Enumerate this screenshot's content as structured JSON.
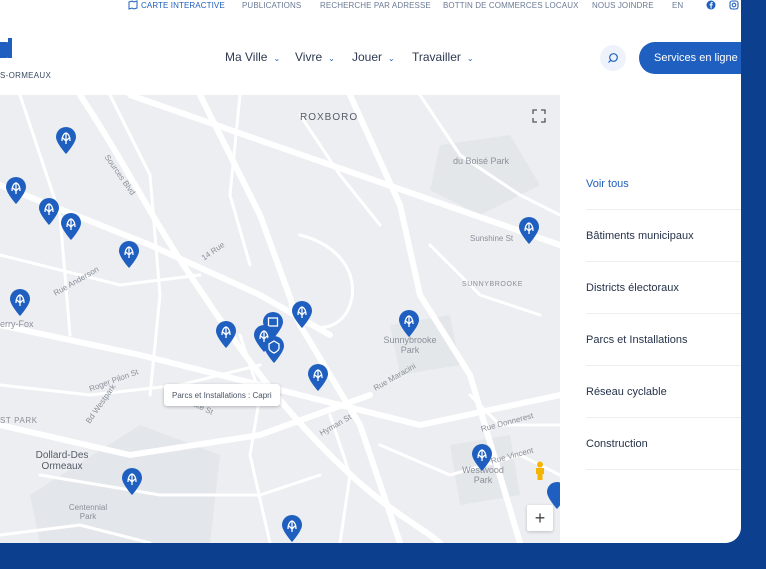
{
  "topbar": {
    "links": [
      "CARTE INTERACTIVE",
      "PUBLICATIONS",
      "RECHERCHE PAR ADRESSE",
      "BOTTIN DE COMMERCES LOCAUX",
      "NOUS JOINDRE",
      "EN"
    ],
    "active_color": "#1f5fbf"
  },
  "logo": {
    "text": "S-ORMEAUX"
  },
  "nav": {
    "items": [
      "Ma Ville",
      "Vivre",
      "Jouer",
      "Travailler"
    ]
  },
  "services_label": "Services en ligne",
  "map": {
    "tooltip": "Parcs et Installations : Capri",
    "labels": [
      "ROXBORO",
      "du Boisé Park",
      "SUNNYBROOKE",
      "Sunshine St",
      "Sunnybrooke Park",
      "Dollard-Des Ormeaux",
      "Centennial Park",
      "Westwood Park",
      "ST PARK",
      "erry-Fox",
      "Sources Blvd",
      "14 Rue",
      "Roger Pilon St",
      "Lake St",
      "Hyman St",
      "Rue Maracini",
      "Rue Donnerest",
      "Rue Vincent",
      "Bd Westpark",
      "Rue Anderson"
    ],
    "marker_color": "#1f5fbf"
  },
  "sidebar": {
    "items": [
      "Voir tous",
      "Bâtiments municipaux",
      "Districts électoraux",
      "Parcs et Installations",
      "Réseau cyclable",
      "Construction"
    ]
  },
  "colors": {
    "brand": "#1f5fbf",
    "frame_bg": "#0d3f8f"
  }
}
